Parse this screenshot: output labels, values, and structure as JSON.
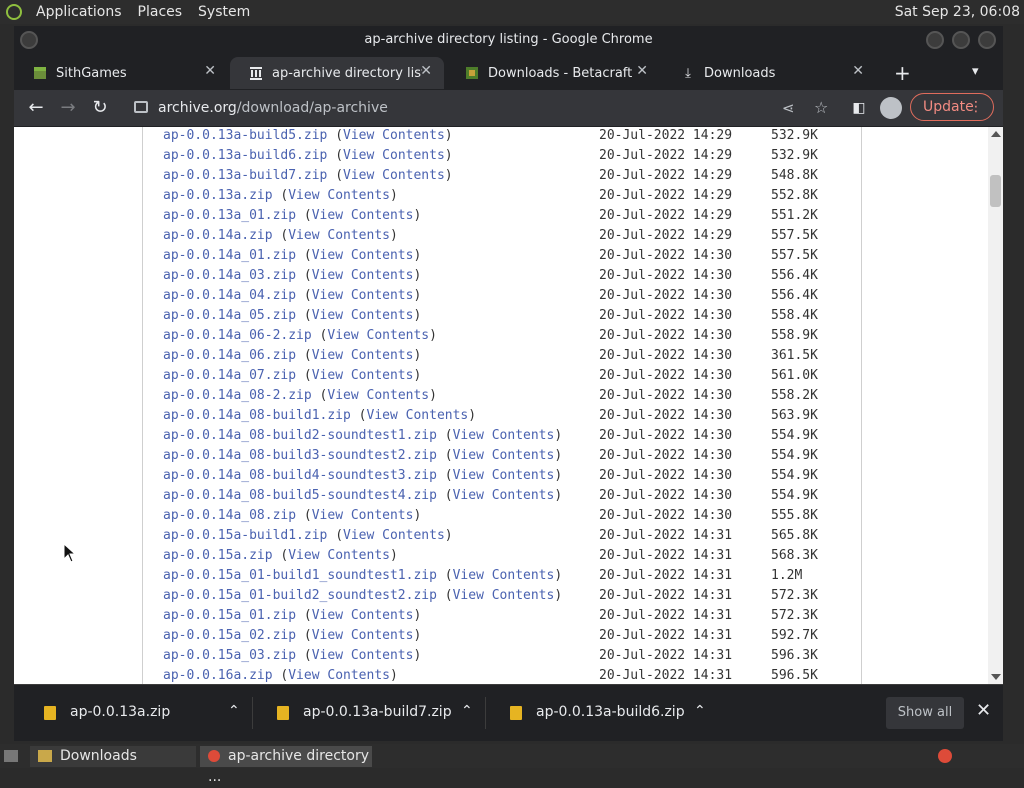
{
  "top_panel": {
    "menus": [
      "Applications",
      "Places",
      "System"
    ],
    "clock": "Sat Sep 23, 06:08"
  },
  "window": {
    "title": "ap-archive directory listing - Google Chrome"
  },
  "tabs": [
    {
      "label": "SithGames",
      "icon": "minecraft-block-icon",
      "active": false
    },
    {
      "label": "ap-archive directory listing",
      "icon": "archive-building-icon",
      "active": true
    },
    {
      "label": "Downloads - Betacraft",
      "icon": "betacraft-icon",
      "active": false
    },
    {
      "label": "Downloads",
      "icon": "download-icon",
      "active": false
    }
  ],
  "toolbar": {
    "url_host": "archive.org",
    "url_path": "/download/ap-archive",
    "update_label": "Update"
  },
  "listing": {
    "link_label": "View Contents",
    "rows": [
      {
        "file": "ap-0.0.13a-build5.zip",
        "date": "20-Jul-2022 14:29",
        "size": "532.9K"
      },
      {
        "file": "ap-0.0.13a-build6.zip",
        "date": "20-Jul-2022 14:29",
        "size": "532.9K"
      },
      {
        "file": "ap-0.0.13a-build7.zip",
        "date": "20-Jul-2022 14:29",
        "size": "548.8K"
      },
      {
        "file": "ap-0.0.13a.zip",
        "date": "20-Jul-2022 14:29",
        "size": "552.8K"
      },
      {
        "file": "ap-0.0.13a_01.zip",
        "date": "20-Jul-2022 14:29",
        "size": "551.2K"
      },
      {
        "file": "ap-0.0.14a.zip",
        "date": "20-Jul-2022 14:29",
        "size": "557.5K"
      },
      {
        "file": "ap-0.0.14a_01.zip",
        "date": "20-Jul-2022 14:30",
        "size": "557.5K"
      },
      {
        "file": "ap-0.0.14a_03.zip",
        "date": "20-Jul-2022 14:30",
        "size": "556.4K"
      },
      {
        "file": "ap-0.0.14a_04.zip",
        "date": "20-Jul-2022 14:30",
        "size": "556.4K"
      },
      {
        "file": "ap-0.0.14a_05.zip",
        "date": "20-Jul-2022 14:30",
        "size": "558.4K"
      },
      {
        "file": "ap-0.0.14a_06-2.zip",
        "date": "20-Jul-2022 14:30",
        "size": "558.9K"
      },
      {
        "file": "ap-0.0.14a_06.zip",
        "date": "20-Jul-2022 14:30",
        "size": "361.5K"
      },
      {
        "file": "ap-0.0.14a_07.zip",
        "date": "20-Jul-2022 14:30",
        "size": "561.0K"
      },
      {
        "file": "ap-0.0.14a_08-2.zip",
        "date": "20-Jul-2022 14:30",
        "size": "558.2K"
      },
      {
        "file": "ap-0.0.14a_08-build1.zip",
        "date": "20-Jul-2022 14:30",
        "size": "563.9K"
      },
      {
        "file": "ap-0.0.14a_08-build2-soundtest1.zip",
        "date": "20-Jul-2022 14:30",
        "size": "554.9K"
      },
      {
        "file": "ap-0.0.14a_08-build3-soundtest2.zip",
        "date": "20-Jul-2022 14:30",
        "size": "554.9K"
      },
      {
        "file": "ap-0.0.14a_08-build4-soundtest3.zip",
        "date": "20-Jul-2022 14:30",
        "size": "554.9K"
      },
      {
        "file": "ap-0.0.14a_08-build5-soundtest4.zip",
        "date": "20-Jul-2022 14:30",
        "size": "554.9K"
      },
      {
        "file": "ap-0.0.14a_08.zip",
        "date": "20-Jul-2022 14:30",
        "size": "555.8K"
      },
      {
        "file": "ap-0.0.15a-build1.zip",
        "date": "20-Jul-2022 14:31",
        "size": "565.8K"
      },
      {
        "file": "ap-0.0.15a.zip",
        "date": "20-Jul-2022 14:31",
        "size": "568.3K"
      },
      {
        "file": "ap-0.0.15a_01-build1_soundtest1.zip",
        "date": "20-Jul-2022 14:31",
        "size": "1.2M"
      },
      {
        "file": "ap-0.0.15a_01-build2_soundtest2.zip",
        "date": "20-Jul-2022 14:31",
        "size": "572.3K"
      },
      {
        "file": "ap-0.0.15a_01.zip",
        "date": "20-Jul-2022 14:31",
        "size": "572.3K"
      },
      {
        "file": "ap-0.0.15a_02.zip",
        "date": "20-Jul-2022 14:31",
        "size": "592.7K"
      },
      {
        "file": "ap-0.0.15a_03.zip",
        "date": "20-Jul-2022 14:31",
        "size": "596.3K"
      },
      {
        "file": "ap-0.0.16a.zip",
        "date": "20-Jul-2022 14:31",
        "size": "596.5K"
      }
    ]
  },
  "downloads": {
    "items": [
      "ap-0.0.13a.zip",
      "ap-0.0.13a-build7.zip",
      "ap-0.0.13a-build6.zip"
    ],
    "show_all": "Show all"
  },
  "taskbar": {
    "items": [
      "Downloads",
      "ap-archive directory ..."
    ]
  },
  "colors": {
    "link": "#4a62b0",
    "update_accent": "#f28b82"
  }
}
